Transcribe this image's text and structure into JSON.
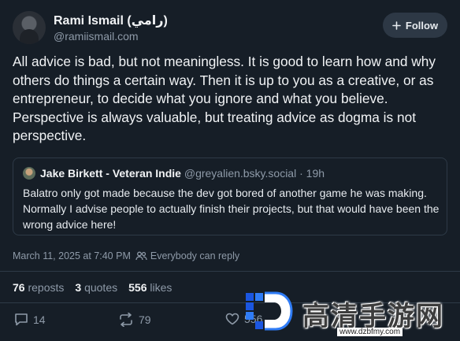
{
  "author": {
    "name": "Rami Ismail (رامي)",
    "handle": "@ramiismail.com"
  },
  "follow_button": {
    "label": "Follow",
    "icon": "plus-icon"
  },
  "post": {
    "text": "All advice is bad, but not meaningless. It is good to learn how and why others do things a certain way. Then it is up to you as a creative, or as entrepreneur, to decide what you ignore and what you believe. Perspective is always valuable, but treating advice as dogma is not perspective."
  },
  "quote": {
    "name": "Jake Birkett - Veteran Indie",
    "handle": "@greyalien.bsky.social",
    "separator": "·",
    "time": "19h",
    "text": "Balatro only got made because the dev got bored of another game he was making. Normally I advise people to actually finish their projects, but that would have been the wrong advice here!"
  },
  "meta": {
    "timestamp": "March 11, 2025 at 7:40 PM",
    "reply_setting": "Everybody can reply",
    "reply_icon": "people-icon"
  },
  "stats": {
    "reposts_count": "76",
    "reposts_label": "reposts",
    "quotes_count": "3",
    "quotes_label": "quotes",
    "likes_count": "556",
    "likes_label": "likes"
  },
  "actions": {
    "reply_count": "14",
    "repost_count": "79",
    "like_count": "556"
  },
  "watermark": {
    "text": "高清手游网",
    "url": "www.dzbfmy.com"
  },
  "colors": {
    "background": "#161e27",
    "text": "#f1f3f5",
    "muted": "#8e9aa8",
    "border": "#2e3a47",
    "button": "#2d3845"
  }
}
